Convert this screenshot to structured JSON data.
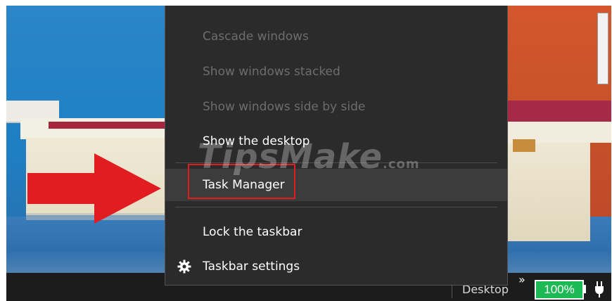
{
  "context_menu": {
    "items": [
      {
        "label": "Cascade windows",
        "enabled": false
      },
      {
        "label": "Show windows stacked",
        "enabled": false
      },
      {
        "label": "Show windows side by side",
        "enabled": false
      },
      {
        "label": "Show the desktop",
        "enabled": true
      },
      {
        "label": "Task Manager",
        "enabled": true,
        "highlighted": true
      },
      {
        "label": "Lock the taskbar",
        "enabled": true
      },
      {
        "label": "Taskbar settings",
        "enabled": true,
        "icon": "gear-icon"
      }
    ]
  },
  "taskbar": {
    "desktop_label": "Desktop",
    "overflow_chevron": "»",
    "battery_percent": "100%",
    "battery_color": "#1db954",
    "power_icon": "plug-icon"
  },
  "watermark": {
    "text": "TipsMake",
    "suffix": ".com"
  },
  "annotations": {
    "arrow_color": "#e11d22",
    "highlight_box_color": "#e11d22"
  }
}
